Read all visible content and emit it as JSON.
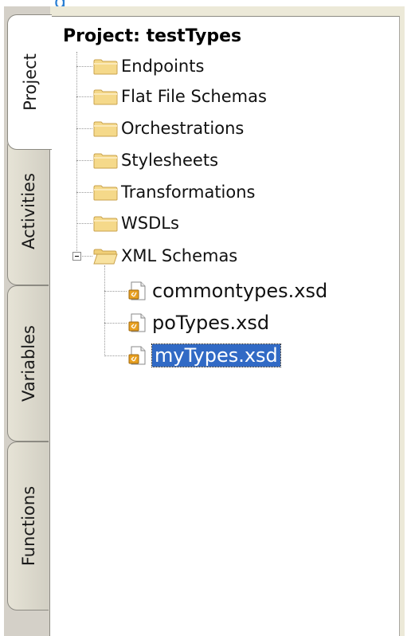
{
  "top_link": "g",
  "tabs": [
    {
      "label": "Project",
      "active": true
    },
    {
      "label": "Activities",
      "active": false
    },
    {
      "label": "Variables",
      "active": false
    },
    {
      "label": "Functions",
      "active": false
    }
  ],
  "project": {
    "title": "Project: testTypes",
    "folders": [
      {
        "label": "Endpoints",
        "icon": "folder-icon"
      },
      {
        "label": "Flat File Schemas",
        "icon": "folder-icon"
      },
      {
        "label": "Orchestrations",
        "icon": "folder-icon"
      },
      {
        "label": "Stylesheets",
        "icon": "folder-icon"
      },
      {
        "label": "Transformations",
        "icon": "folder-icon"
      },
      {
        "label": "WSDLs",
        "icon": "folder-icon"
      },
      {
        "label": "XML Schemas",
        "icon": "open-folder-icon",
        "expanded": true
      }
    ],
    "schema_files": [
      {
        "label": "commontypes.xsd",
        "icon": "xsd-file-icon",
        "selected": false
      },
      {
        "label": "poTypes.xsd",
        "icon": "xsd-file-icon",
        "selected": false
      },
      {
        "label": "myTypes.xsd",
        "icon": "xsd-file-icon",
        "selected": true
      }
    ]
  },
  "colors": {
    "selection": "#316ac5",
    "tab_strip": "#d4d0c8",
    "folder": "#f3d27a"
  }
}
